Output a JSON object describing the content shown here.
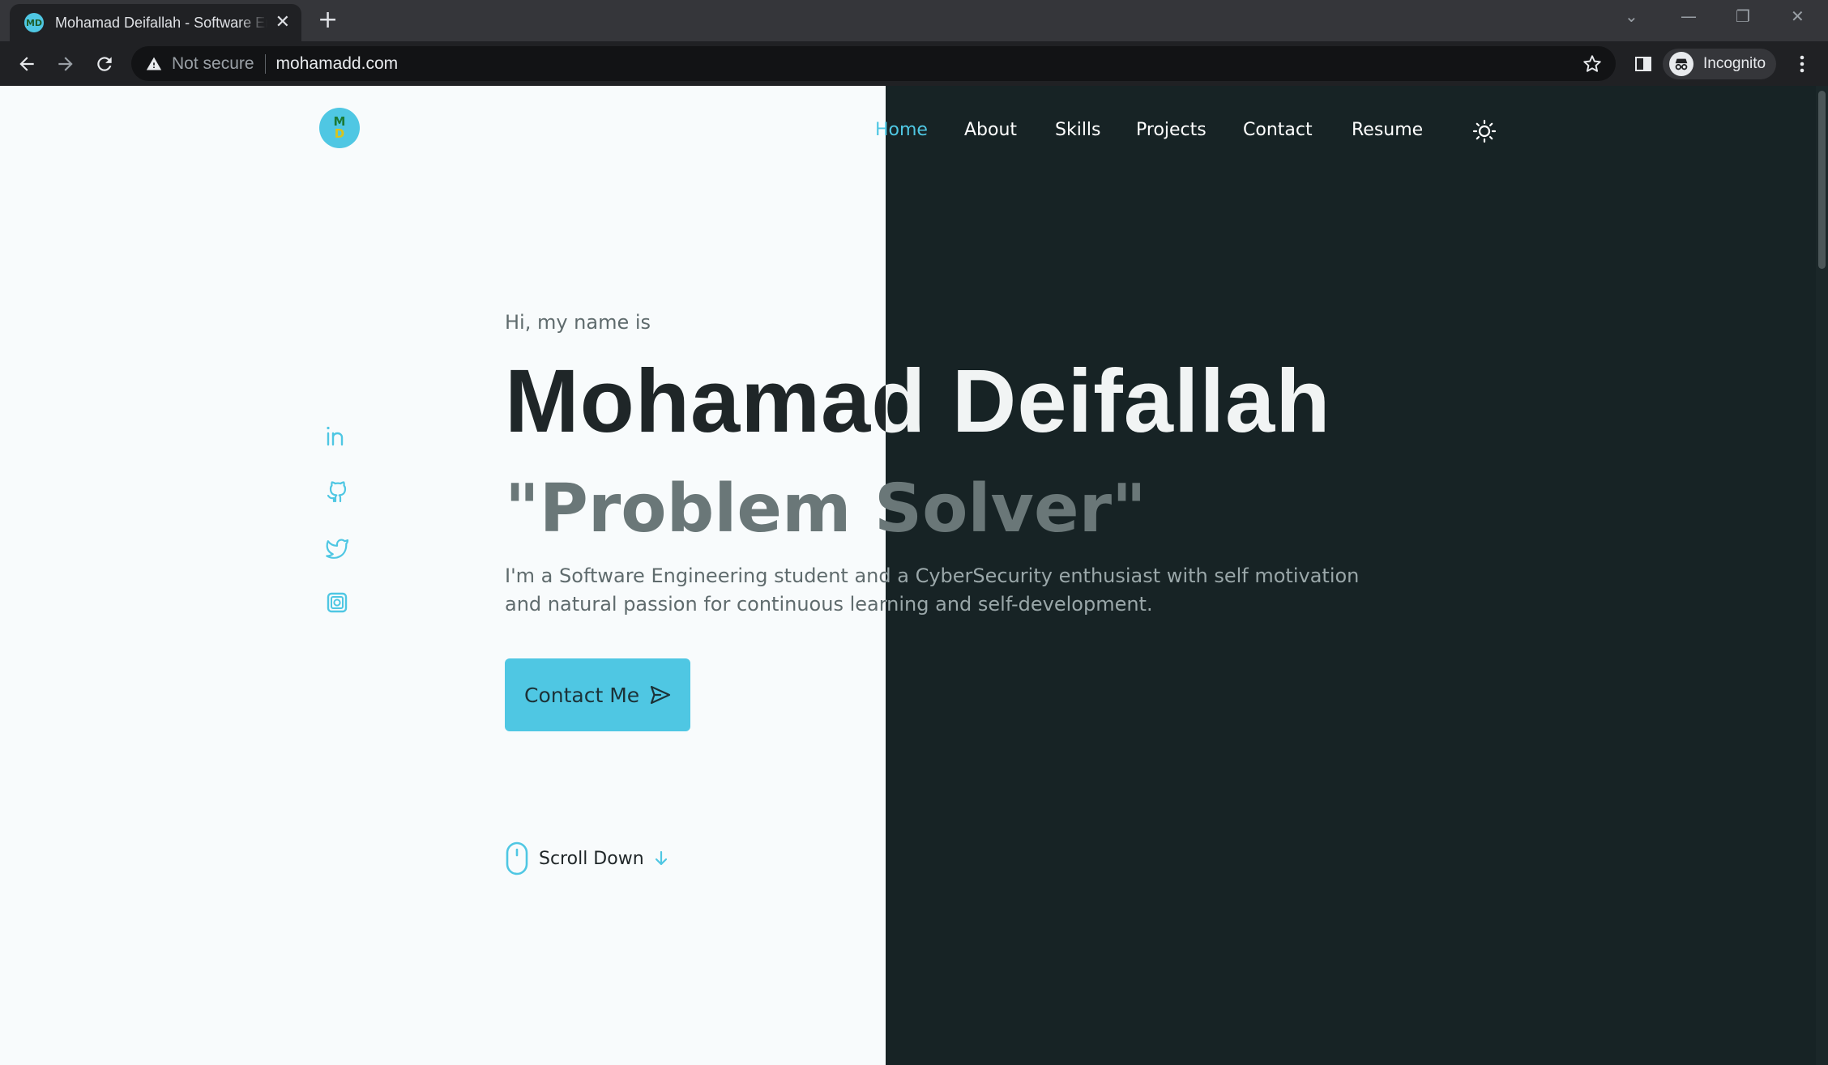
{
  "browser": {
    "tab_title": "Mohamad Deifallah - Software Engineer",
    "tab_close": "✕",
    "new_tab": "+",
    "security_label": "Not secure",
    "url": "mohamadd.com",
    "incognito_label": "Incognito"
  },
  "header": {
    "logo_top": "M",
    "logo_bottom": "D",
    "nav": {
      "home": "Home",
      "about": "About",
      "skills": "Skills",
      "projects": "Projects",
      "contact": "Contact",
      "resume": "Resume"
    }
  },
  "hero": {
    "greeting": "Hi, my name is",
    "name": "Mohamad Deifallah",
    "title": "\"Problem Solver\"",
    "bio": "I'm a Software Engineering student and a CyberSecurity enthusiast with self motivation and natural passion for continuous learning and self-development.",
    "cta_label": "Contact Me",
    "scroll_label": "Scroll Down"
  },
  "social": [
    "linkedin-icon",
    "github-icon",
    "twitter-icon",
    "instagram-icon"
  ],
  "colors": {
    "accent": "#4fc7e3",
    "dark_bg": "#172325",
    "light_bg": "#f8fbfc",
    "heading_dark": "#1f2628",
    "muted": "#6a7778"
  }
}
